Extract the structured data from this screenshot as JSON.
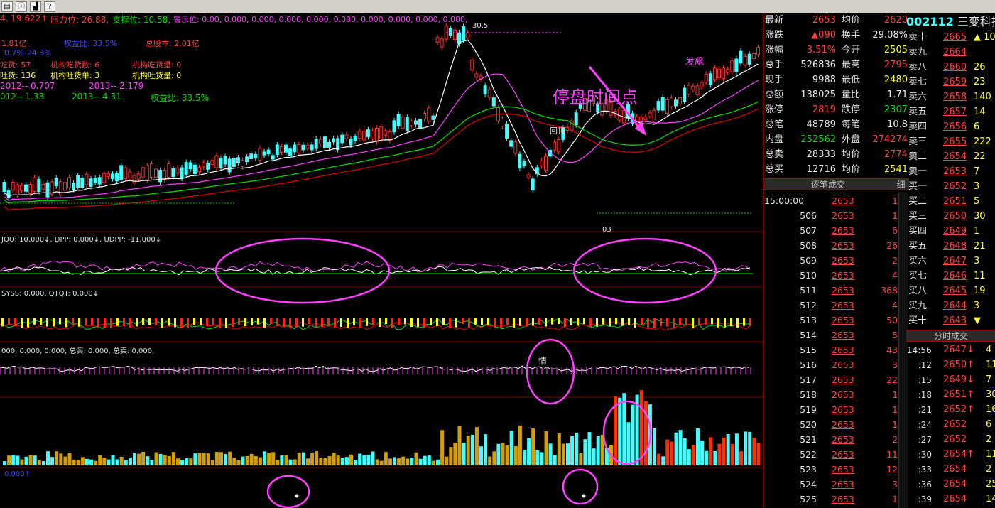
{
  "toolbar": {
    "icons": [
      "list-icon",
      "info-icon",
      "chart-icon",
      "help-icon"
    ],
    "help_glyph": "?"
  },
  "header": {
    "line1_prefix": "4. 19.622↑",
    "pressure_label": "压力位: 26.88,",
    "support_label": "支撑位: 10.58,",
    "warn_label": "警示位: 0.00, 0.000, 0.000, 0.000, 0.000, 0.000, 0.000, 0.000, 0.000, 0.000,",
    "r2_a": "1.81亿",
    "r2_b": "权益比: 33.5%",
    "r2_c": "总股本: 2.01亿",
    "r3": "0.7%-24.3%",
    "r4_a": "吃货: 57",
    "r4_b": "机构吃货数: 6",
    "r4_c": "机构吃货量: 0",
    "r5_a": "吐货: 136",
    "r5_b": "机构吐货单: 3",
    "r5_c": "机构吐货量: 0",
    "r6_a": "2012-- 0.707",
    "r6_b": "2013-- 2.179",
    "r7_a": "012-- 1.33",
    "r7_b": "2013-- 4.31",
    "r7_c": "权益比: 33.5%"
  },
  "annotations": {
    "stop_time": "停盘时间点",
    "fa_biao": "发飙",
    "hui_ding": "回顶",
    "qing": "情",
    "p30": "30.5",
    "low_mark": "03"
  },
  "indicators": {
    "ind1": "JOO: 10.000↓, DPP: 0.000↓, UDPP: -11.000↓",
    "ind2": "SYSS: 0.000, QTQT: 0.000↓",
    "ind3": "000, 0.000, 0.000,  总买: 0.000, 总卖: 0.000,",
    "ind4": "0.000↑"
  },
  "quote": {
    "rows": [
      {
        "l": "最新",
        "v": "2653",
        "l2": "均价",
        "v2": "2620",
        "vc": "red",
        "v2c": "red"
      },
      {
        "l": "涨跌",
        "v": "▲090",
        "l2": "换手",
        "v2": "29.08%",
        "vc": "red",
        "v2c": "wht"
      },
      {
        "l": "涨幅",
        "v": "3.51%",
        "l2": "今开",
        "v2": "2505",
        "vc": "red",
        "v2c": "yel"
      },
      {
        "l": "总手",
        "v": "526836",
        "l2": "最高",
        "v2": "2795",
        "vc": "wht",
        "v2c": "red"
      },
      {
        "l": "现手",
        "v": "9988",
        "l2": "最低",
        "v2": "2480",
        "vc": "wht",
        "v2c": "yel"
      },
      {
        "l": "总额",
        "v": "138025",
        "l2": "量比",
        "v2": "1.71",
        "vc": "wht",
        "v2c": "wht"
      },
      {
        "l": "涨停",
        "v": "2819",
        "l2": "跌停",
        "v2": "2307",
        "vc": "red",
        "v2c": "grn"
      },
      {
        "l": "总笔",
        "v": "48789",
        "l2": "每笔",
        "v2": "10.8",
        "vc": "wht",
        "v2c": "wht"
      },
      {
        "l": "内盘",
        "v": "252562",
        "l2": "外盘",
        "v2": "274274",
        "vc": "grn",
        "v2c": "red"
      },
      {
        "l": "总卖",
        "v": "28333",
        "l2": "均价",
        "v2": "2774",
        "vc": "wht",
        "v2c": "red"
      },
      {
        "l": "总买",
        "v": "12716",
        "l2": "均价",
        "v2": "2541",
        "vc": "wht",
        "v2c": "yel"
      }
    ],
    "tick_header": "逐笔成交",
    "tick_detail_btn": "细",
    "ticks": [
      {
        "t": "15:00:00",
        "p": "2653",
        "v": "1"
      },
      {
        "t": "506",
        "p": "2653",
        "v": "1"
      },
      {
        "t": "507",
        "p": "2653",
        "v": "6"
      },
      {
        "t": "508",
        "p": "2653",
        "v": "26"
      },
      {
        "t": "509",
        "p": "2653",
        "v": "2"
      },
      {
        "t": "510",
        "p": "2653",
        "v": "4"
      },
      {
        "t": "511",
        "p": "2653",
        "v": "368"
      },
      {
        "t": "512",
        "p": "2653",
        "v": "4"
      },
      {
        "t": "513",
        "p": "2653",
        "v": "50"
      },
      {
        "t": "514",
        "p": "2653",
        "v": "5"
      },
      {
        "t": "515",
        "p": "2653",
        "v": "43"
      },
      {
        "t": "516",
        "p": "2653",
        "v": "3"
      },
      {
        "t": "517",
        "p": "2653",
        "v": "22"
      },
      {
        "t": "518",
        "p": "2653",
        "v": "1"
      },
      {
        "t": "519",
        "p": "2653",
        "v": "1"
      },
      {
        "t": "520",
        "p": "2653",
        "v": "1"
      },
      {
        "t": "521",
        "p": "2653",
        "v": "2"
      },
      {
        "t": "522",
        "p": "2653",
        "v": "11"
      },
      {
        "t": "523",
        "p": "2653",
        "v": "12"
      },
      {
        "t": "524",
        "p": "2653",
        "v": "3"
      },
      {
        "t": "525",
        "p": "2653",
        "v": "1"
      }
    ]
  },
  "orderbook": {
    "stock_code": "002112",
    "stock_name": "三变科技",
    "asks": [
      {
        "l": "卖十",
        "p": "2665",
        "v": "▲ 10"
      },
      {
        "l": "卖九",
        "p": "2664",
        "v": ""
      },
      {
        "l": "卖八",
        "p": "2660",
        "v": "26"
      },
      {
        "l": "卖七",
        "p": "2659",
        "v": "23"
      },
      {
        "l": "卖六",
        "p": "2658",
        "v": "140"
      },
      {
        "l": "卖五",
        "p": "2657",
        "v": "14"
      },
      {
        "l": "卖四",
        "p": "2656",
        "v": "6"
      },
      {
        "l": "卖三",
        "p": "2655",
        "v": "222"
      },
      {
        "l": "卖二",
        "p": "2654",
        "v": "22"
      },
      {
        "l": "卖一",
        "p": "2653",
        "v": "7"
      }
    ],
    "bids": [
      {
        "l": "买一",
        "p": "2652",
        "v": "3"
      },
      {
        "l": "买二",
        "p": "2651",
        "v": "5"
      },
      {
        "l": "买三",
        "p": "2650",
        "v": "30"
      },
      {
        "l": "买四",
        "p": "2649",
        "v": "1"
      },
      {
        "l": "买五",
        "p": "2648",
        "v": "21"
      },
      {
        "l": "买六",
        "p": "2647",
        "v": "3"
      },
      {
        "l": "买七",
        "p": "2646",
        "v": "11"
      },
      {
        "l": "买八",
        "p": "2645",
        "v": "19"
      },
      {
        "l": "买九",
        "p": "2644",
        "v": "3"
      },
      {
        "l": "买十",
        "p": "2643",
        "v": "▼"
      }
    ],
    "min_header": "分时成交",
    "min_trades": [
      {
        "t": "14:56",
        "p": "2647↓",
        "v": "4"
      },
      {
        "t": ":12",
        "p": "2650↑",
        "v": "11"
      },
      {
        "t": ":15",
        "p": "2649↓",
        "v": "7"
      },
      {
        "t": ":18",
        "p": "2651↑",
        "v": "30"
      },
      {
        "t": ":21",
        "p": "2652↑",
        "v": "16"
      },
      {
        "t": ":24",
        "p": "2652",
        "v": "6"
      },
      {
        "t": ":27",
        "p": "2652",
        "v": "2"
      },
      {
        "t": ":30",
        "p": "2654↑",
        "v": "11"
      },
      {
        "t": ":33",
        "p": "2654",
        "v": "2"
      },
      {
        "t": ":36",
        "p": "2654",
        "v": "25"
      },
      {
        "t": ":39",
        "p": "2654",
        "v": "14"
      }
    ]
  }
}
